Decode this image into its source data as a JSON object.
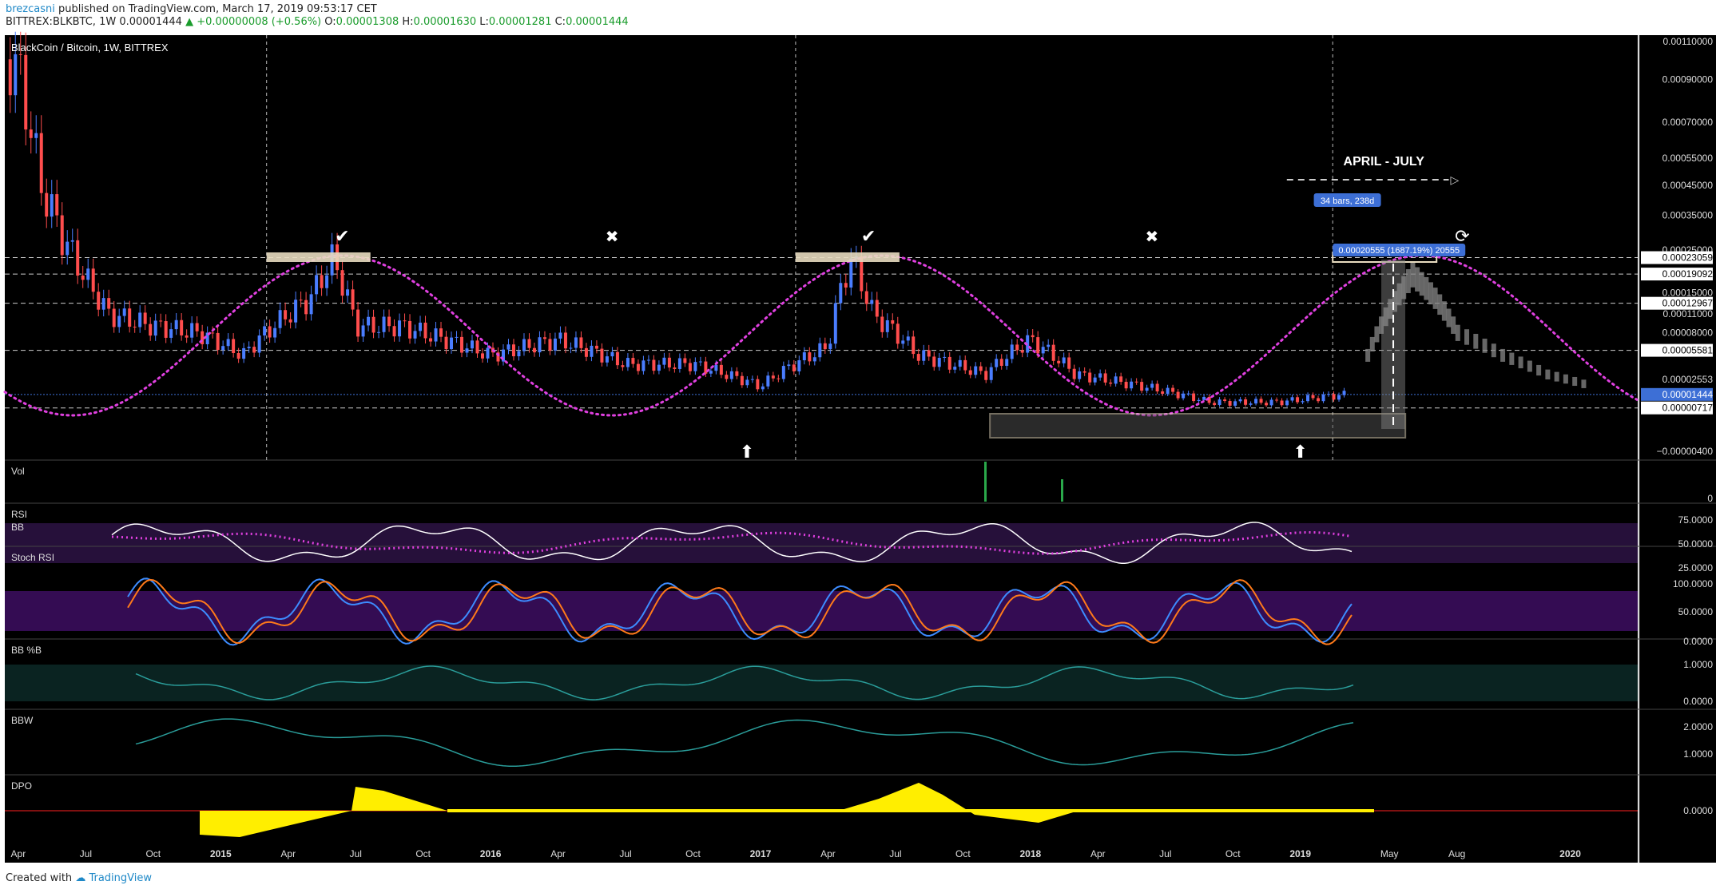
{
  "header": {
    "author": "brezcasni",
    "published": "published on TradingView.com, March 17, 2019 09:53:17 CET",
    "symbol": "BITTREX:BLKBTC, 1W",
    "price": "0.00001444",
    "change_arrow": "▲",
    "change": "+0.00000008 (+0.56%)",
    "o_label": "O:",
    "o_val": "0.00001308",
    "h_label": "H:",
    "h_val": "0.00001630",
    "l_label": "L:",
    "l_val": "0.00001281",
    "c_label": "C:",
    "c_val": "0.00001444"
  },
  "footer": {
    "created_with": "Created with",
    "brand": "TradingView"
  },
  "colors": {
    "background": "#000000",
    "up": "#4a7dff",
    "down": "#ff4d4d",
    "cycle": "#e040e0",
    "rsi": "#ffffff",
    "stoch_k": "#3d8cff",
    "stoch_d": "#ff7a1a",
    "dpo": "#ffee00",
    "teal": "#2a9d9a"
  },
  "chart_data": {
    "type": "line",
    "title": "BlackCoin / Bitcoin, 1W, BITTREX",
    "x_labels": [
      "Apr",
      "Jul",
      "Oct",
      "2015",
      "Apr",
      "Jul",
      "Oct",
      "2016",
      "Apr",
      "Jul",
      "Oct",
      "2017",
      "Apr",
      "Jul",
      "Oct",
      "2018",
      "Apr",
      "Jul",
      "Oct",
      "2019",
      "May",
      "Aug",
      "2020"
    ],
    "price_axis_labels": [
      "0.00110000",
      "0.00090000",
      "0.00070000",
      "0.00055000",
      "0.00045000",
      "0.00035000",
      "0.00025000",
      "0.00015000",
      "0.00011000",
      "0.00008000",
      "0.00002553",
      "−0.00000400"
    ],
    "price_marked_levels": [
      "0.00023059",
      "0.00019092",
      "0.00012967",
      "0.00005581",
      "0.00001444",
      "0.00000717"
    ],
    "price_series": [
      {
        "x": "2014-03",
        "v": 0.0011
      },
      {
        "x": "2014-04",
        "v": 0.00095
      },
      {
        "x": "2014-05",
        "v": 0.00045
      },
      {
        "x": "2014-06",
        "v": 0.00028
      },
      {
        "x": "2014-07",
        "v": 0.00018
      },
      {
        "x": "2014-08",
        "v": 0.00011
      },
      {
        "x": "2014-10",
        "v": 9e-05
      },
      {
        "x": "2014-12",
        "v": 8e-05
      },
      {
        "x": "2015-02",
        "v": 5e-05
      },
      {
        "x": "2015-05",
        "v": 0.00014
      },
      {
        "x": "2015-06",
        "v": 0.00023
      },
      {
        "x": "2015-07",
        "v": 9e-05
      },
      {
        "x": "2015-09",
        "v": 9e-05
      },
      {
        "x": "2015-11",
        "v": 7e-05
      },
      {
        "x": "2016-01",
        "v": 5e-05
      },
      {
        "x": "2016-04",
        "v": 7e-05
      },
      {
        "x": "2016-07",
        "v": 4e-05
      },
      {
        "x": "2016-10",
        "v": 4e-05
      },
      {
        "x": "2017-01",
        "v": 2e-05
      },
      {
        "x": "2017-04",
        "v": 6e-05
      },
      {
        "x": "2017-05",
        "v": 0.00023
      },
      {
        "x": "2017-06",
        "v": 0.00011
      },
      {
        "x": "2017-08",
        "v": 5e-05
      },
      {
        "x": "2017-11",
        "v": 3e-05
      },
      {
        "x": "2018-01",
        "v": 7e-05
      },
      {
        "x": "2018-03",
        "v": 3e-05
      },
      {
        "x": "2018-06",
        "v": 2e-05
      },
      {
        "x": "2018-09",
        "v": 1e-05
      },
      {
        "x": "2018-12",
        "v": 1e-05
      },
      {
        "x": "2019-03",
        "v": 1.444e-05
      }
    ],
    "projection_series": [
      {
        "x": "2019-04",
        "v": 5e-05
      },
      {
        "x": "2019-05",
        "v": 0.00012
      },
      {
        "x": "2019-06",
        "v": 0.00019
      },
      {
        "x": "2019-07",
        "v": 0.00014
      },
      {
        "x": "2019-08",
        "v": 8e-05
      },
      {
        "x": "2019-10",
        "v": 5e-05
      },
      {
        "x": "2019-12",
        "v": 3e-05
      },
      {
        "x": "2020-02",
        "v": 2e-05
      }
    ],
    "annotations": {
      "range_label": "APRIL - JULY",
      "bars_label": "34 bars, 238d",
      "measure_label": "0.00020555 (1687.19%) 20555",
      "check_marks": [
        "✔",
        "✔"
      ],
      "x_marks": [
        "✖",
        "✖"
      ]
    },
    "panes": [
      {
        "name": "Vol",
        "axis": [
          "0"
        ]
      },
      {
        "name": "RSI",
        "sub": "BB",
        "axis": [
          "75.0000",
          "50.0000",
          "25.0000"
        ]
      },
      {
        "name": "Stoch RSI",
        "axis": [
          "100.0000",
          "50.0000",
          "0.0000"
        ]
      },
      {
        "name": "BB %B",
        "axis": [
          "1.0000",
          "0.0000"
        ]
      },
      {
        "name": "BBW",
        "axis": [
          "2.0000",
          "1.0000"
        ]
      },
      {
        "name": "DPO",
        "axis": [
          "0.0000"
        ]
      }
    ]
  }
}
